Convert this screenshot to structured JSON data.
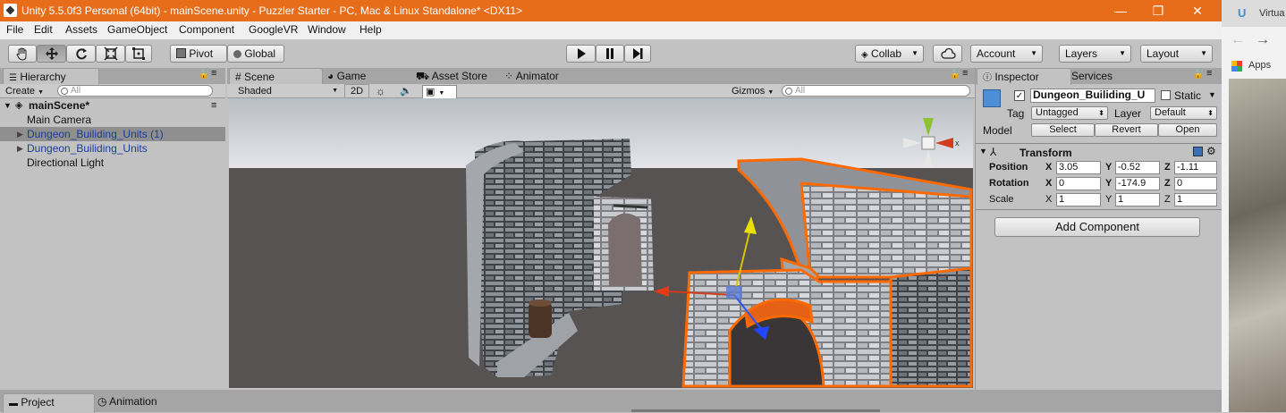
{
  "window": {
    "title": "Unity 5.5.0f3 Personal (64bit) - mainScene.unity - Puzzler Starter - PC, Mac & Linux Standalone* <DX11>",
    "minimize": "—",
    "maximize": "❐",
    "close": "✕"
  },
  "menu": [
    "File",
    "Edit",
    "Assets",
    "GameObject",
    "Component",
    "GoogleVR",
    "Window",
    "Help"
  ],
  "toolbar": {
    "pivot": "Pivot",
    "global": "Global",
    "collab": "Collab",
    "account": "Account",
    "layers": "Layers",
    "layout": "Layout"
  },
  "hierarchy": {
    "tab": "Hierarchy",
    "create": "Create",
    "search_placeholder": "All",
    "scene": "mainScene*",
    "items": [
      "Main Camera",
      "Dungeon_Builiding_Units (1)",
      "Dungeon_Builiding_Units",
      "Directional Light"
    ]
  },
  "scene": {
    "tabs": [
      "Scene",
      "Game",
      "Asset Store",
      "Animator"
    ],
    "shading": "Shaded",
    "mode2d": "2D",
    "gizmos": "Gizmos",
    "search_placeholder": "All",
    "gizmo_axis_x": "x"
  },
  "inspector": {
    "tabs": [
      "Inspector",
      "Services"
    ],
    "object_name": "Dungeon_Builiding_U",
    "static_label": "Static",
    "tag_label": "Tag",
    "tag_value": "Untagged",
    "layer_label": "Layer",
    "layer_value": "Default",
    "model_label": "Model",
    "model_buttons": [
      "Select",
      "Revert",
      "Open"
    ],
    "transform_title": "Transform",
    "position_label": "Position",
    "rotation_label": "Rotation",
    "scale_label": "Scale",
    "axis": [
      "X",
      "Y",
      "Z"
    ],
    "position": [
      "3.05",
      "-0.52",
      "-1.11"
    ],
    "rotation": [
      "0",
      "-174.9",
      "0"
    ],
    "scale": [
      "1",
      "1",
      "1"
    ],
    "add_component": "Add Component"
  },
  "bottom": {
    "tabs": [
      "Project",
      "Animation"
    ]
  },
  "browser": {
    "tab_title": "Virtua",
    "apps_label": "Apps"
  },
  "colors": {
    "title_bar": "#e86d1b",
    "selection_outline": "#ff6a00",
    "sky": "#d9dde3",
    "ground": "#575353"
  }
}
